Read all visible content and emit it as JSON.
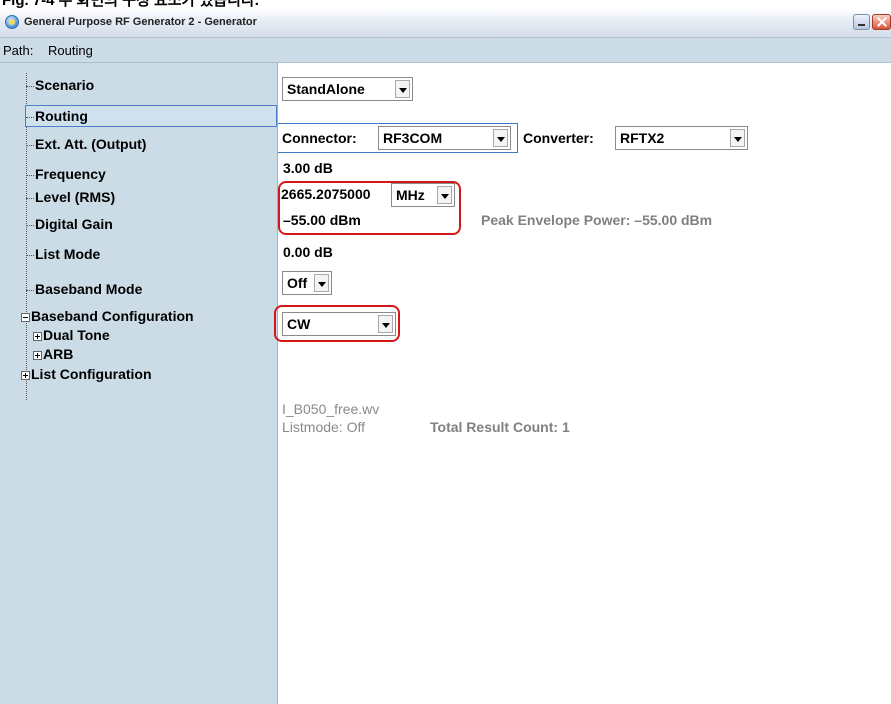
{
  "caption": "Fig. 7-4 주 화면의 구성 요소가 있습니다.",
  "window": {
    "title": "General Purpose RF Generator 2 - Generator"
  },
  "path": {
    "label": "Path:",
    "value": "Routing"
  },
  "tree": {
    "scenario": "Scenario",
    "routing": "Routing",
    "ext_att": "Ext. Att. (Output)",
    "frequency": "Frequency",
    "level": "Level (RMS)",
    "digital_gain": "Digital Gain",
    "list_mode": "List Mode",
    "baseband_mode": "Baseband Mode",
    "baseband_configuration": "Baseband Configuration",
    "dual_tone": "Dual Tone",
    "arb": "ARB",
    "list_configuration": "List Configuration"
  },
  "values": {
    "scenario": "StandAlone",
    "connector_label": "Connector:",
    "connector": "RF3COM",
    "converter_label": "Converter:",
    "converter": "RFTX2",
    "ext_att": "3.00 dB",
    "frequency": "2665.2075000",
    "frequency_unit": "MHz",
    "level": "–55.00 dBm",
    "peak_envelope": "Peak Envelope Power:  –55.00 dBm",
    "digital_gain": "0.00 dB",
    "list_mode": "Off",
    "baseband_mode": "CW",
    "arb_file": "I_B050_free.wv",
    "listmode_status": "Listmode: Off",
    "total_result_count": "Total Result Count:  1"
  },
  "colors": {
    "tree_background": "#cbdce6",
    "highlight_outline": "#d21919",
    "selection_border": "#3a7ac0"
  }
}
